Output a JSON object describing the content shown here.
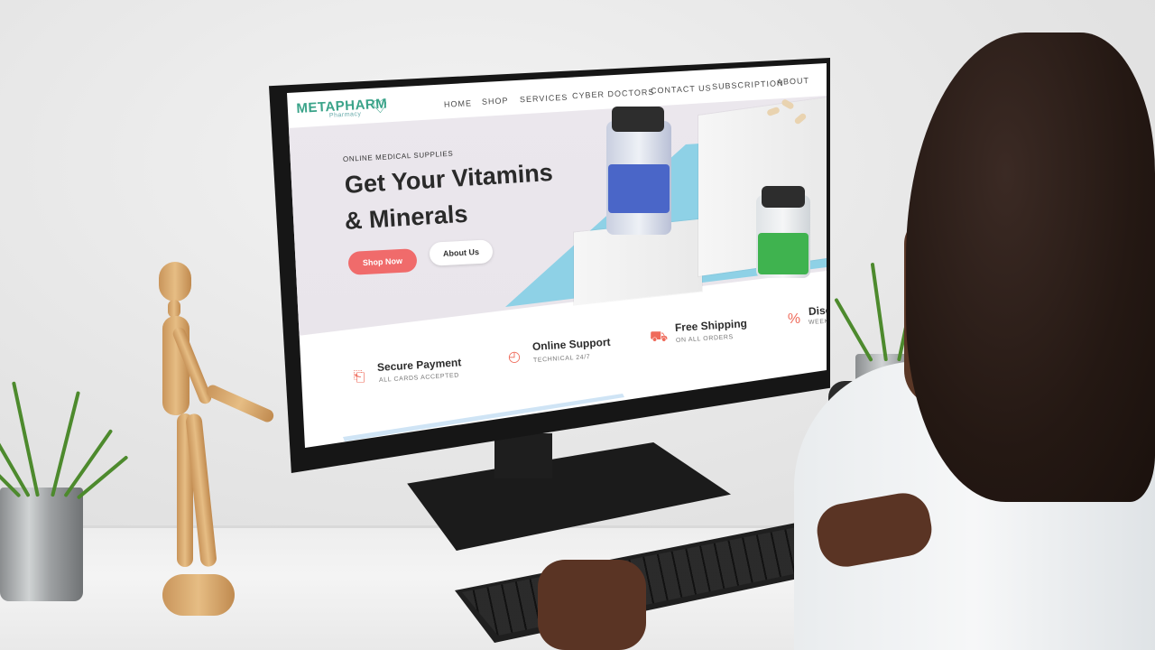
{
  "site": {
    "logo": {
      "name": "METAPHARM",
      "tagline": "Pharmacy"
    },
    "nav": [
      "HOME",
      "SHOP",
      "SERVICES",
      "CYBER DOCTORS",
      "CONTACT US",
      "SUBSCRIPTION",
      "ABOUT"
    ],
    "hero": {
      "eyebrow": "ONLINE MEDICAL SUPPLIES",
      "title_line1": "Get Your Vitamins",
      "title_line2": "& Minerals",
      "primary_button": "Shop Now",
      "secondary_button": "About Us"
    },
    "features": [
      {
        "title": "Secure Payment",
        "subtitle": "ALL CARDS ACCEPTED",
        "icon": "box-hand-icon"
      },
      {
        "title": "Online Support",
        "subtitle": "TECHNICAL 24/7",
        "icon": "24h-support-icon"
      },
      {
        "title": "Free Shipping",
        "subtitle": "ON ALL ORDERS",
        "icon": "truck-icon"
      },
      {
        "title": "Disco",
        "subtitle": "WEEK",
        "icon": "discount-icon"
      }
    ],
    "colors": {
      "accent": "#f06b6b",
      "brand": "#3aa389",
      "hero_bg": "#ece8ee"
    }
  }
}
